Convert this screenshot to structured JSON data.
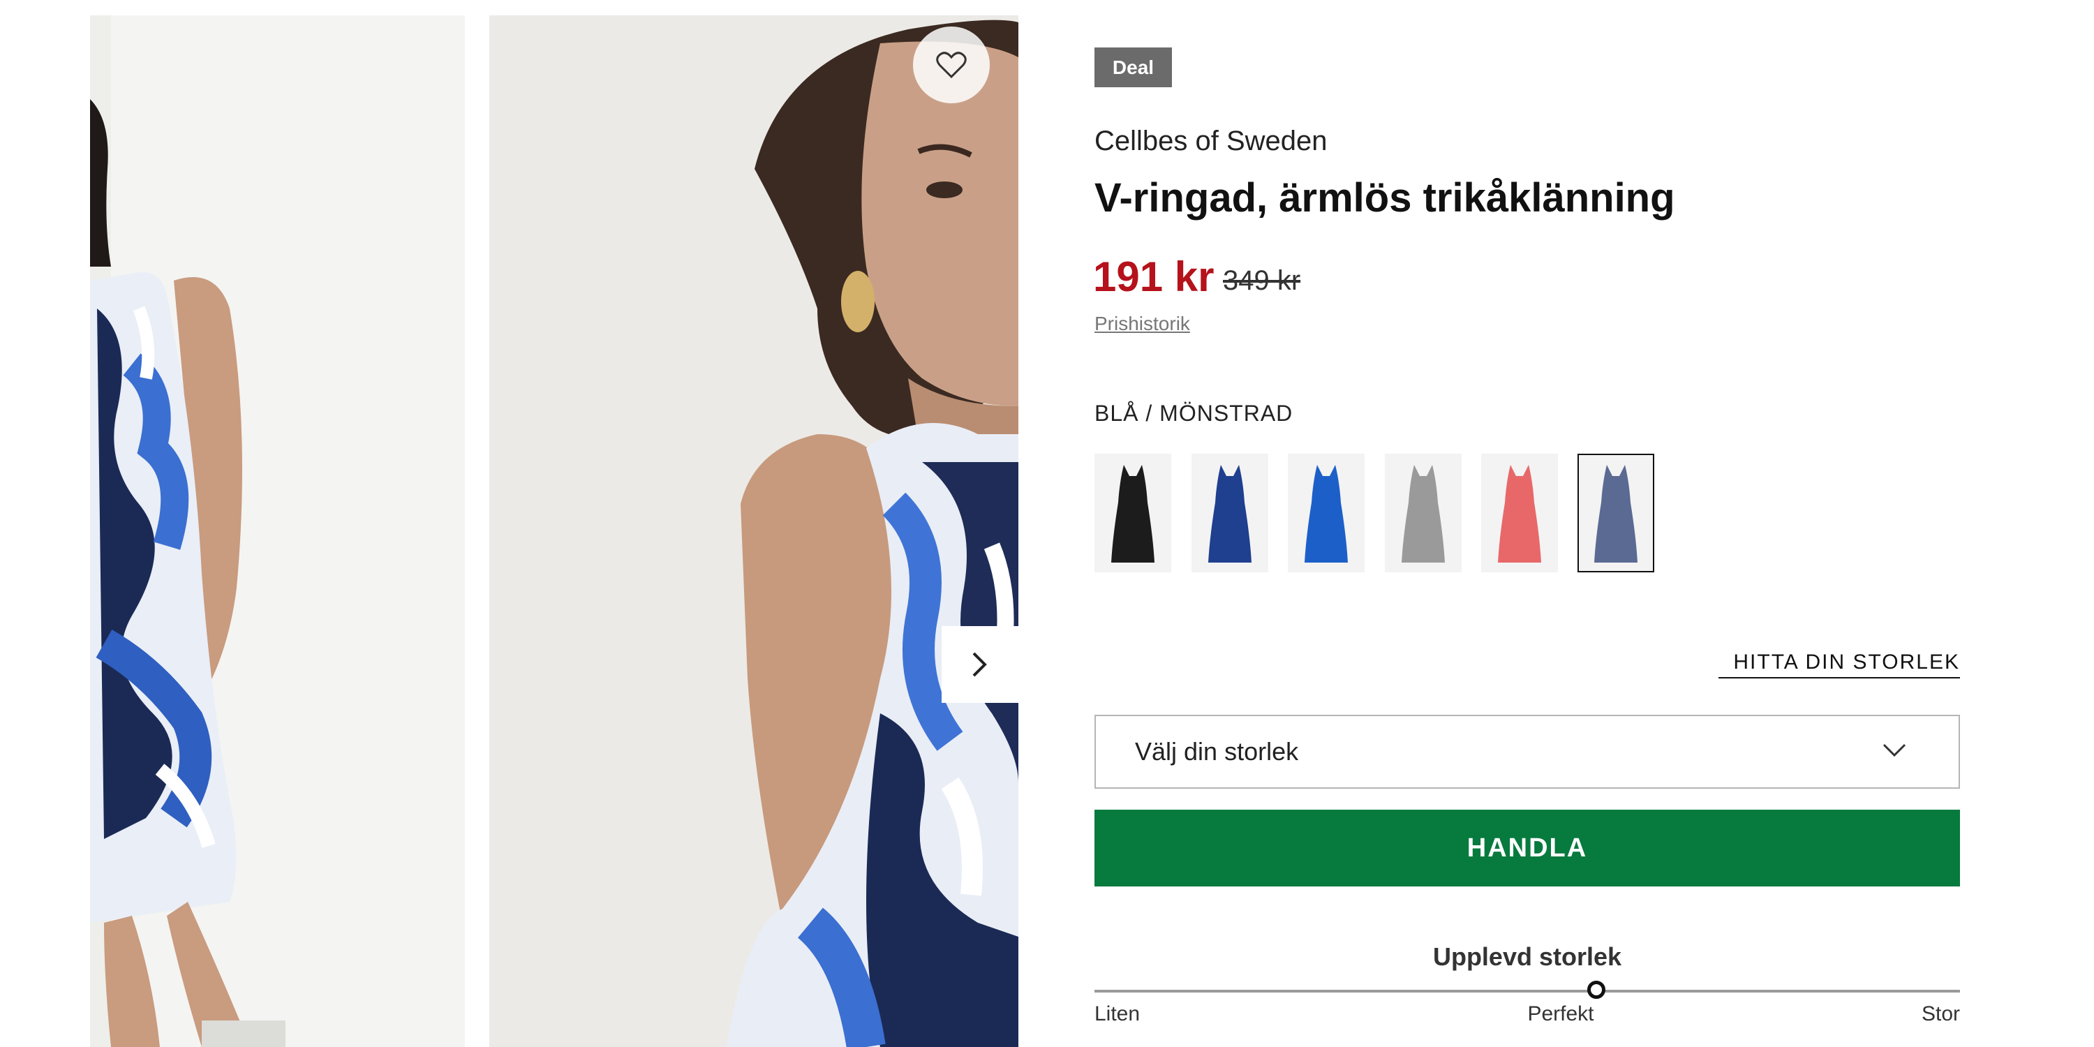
{
  "gallery": {
    "images": [
      {
        "icon": "model-full-body-photo"
      },
      {
        "icon": "model-closeup-photo"
      }
    ],
    "wishlist_icon": "heart-icon",
    "next_icon": "chevron-right-icon"
  },
  "product": {
    "badge": "Deal",
    "brand": "Cellbes of Sweden",
    "title": "V-ringad, ärmlös trikåklänning",
    "price": "191 kr",
    "old_price": "349 kr",
    "price_history_link": "Prishistorik",
    "color_label": "BLÅ / MÖNSTRAD",
    "colors": [
      {
        "name": "black",
        "hex": "#1c1c1c",
        "selected": false
      },
      {
        "name": "navy",
        "hex": "#1f3f8f",
        "selected": false
      },
      {
        "name": "royal-blue",
        "hex": "#1d5fc9",
        "selected": false
      },
      {
        "name": "grey-pattern",
        "hex": "#9a9a9a",
        "selected": false
      },
      {
        "name": "coral-pattern",
        "hex": "#e8686a",
        "selected": false
      },
      {
        "name": "blue-pattern",
        "hex": "#5b6a92",
        "selected": true
      }
    ]
  },
  "size": {
    "find_size_link": "HITTA DIN STORLEK",
    "select_placeholder": "Välj din storlek",
    "select_icon": "chevron-down-icon"
  },
  "actions": {
    "buy_label": "HANDLA"
  },
  "fit": {
    "title": "Upplevd storlek",
    "labels": [
      "Liten",
      "Perfekt",
      "Stor"
    ],
    "value_fraction": 0.58
  },
  "colors": {
    "sale_red": "#b5121b",
    "buy_green": "#077a3e",
    "badge_grey": "#6b6b6b"
  }
}
